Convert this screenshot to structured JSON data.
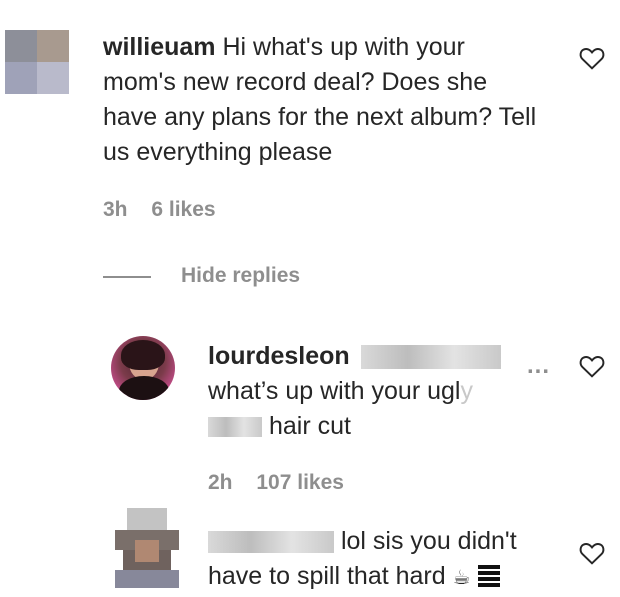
{
  "comments": [
    {
      "username": "willieuam",
      "text": "Hi what's up with your mom's new record deal? Does she have any plans for the next album? Tell us everything please",
      "time": "3h",
      "likes": "6 likes"
    }
  ],
  "thread": {
    "hide_replies_label": "Hide replies"
  },
  "replies": [
    {
      "username": "lourdesleon",
      "line1": "what’s up with your ugl",
      "line2": "hair cut",
      "time": "2h",
      "likes": "107 likes",
      "more_label": "..."
    },
    {
      "line1": "lol sis you didn't",
      "line2": "have to spill that hard",
      "emoji": "☕"
    }
  ],
  "colors": {
    "text": "#262626",
    "muted": "#8e8e8e"
  }
}
